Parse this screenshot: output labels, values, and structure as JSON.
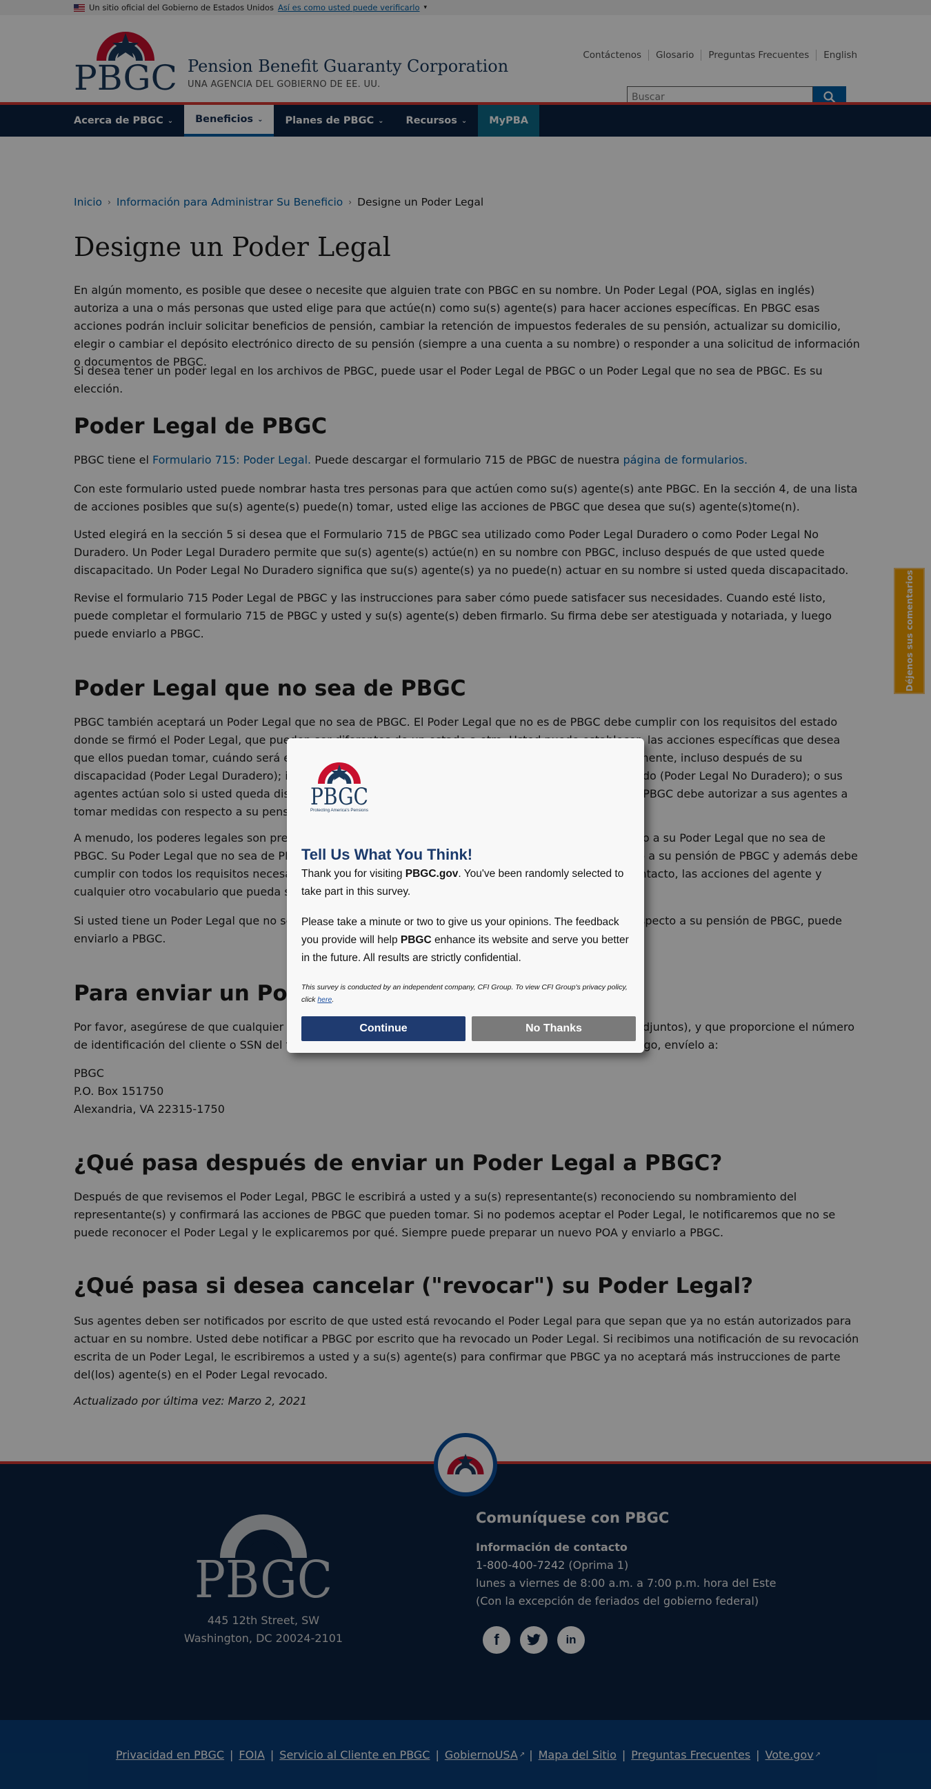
{
  "gov_banner": {
    "text": "Un sitio oficial del Gobierno de Estados Unidos",
    "link": "Así es como usted puede verificarlo"
  },
  "header": {
    "org_name": "Pension Benefit Guaranty Corporation",
    "org_sub": "UNA AGENCIA DEL GOBIERNO DE EE. UU.",
    "util_links": [
      "Contáctenos",
      "Glosario",
      "Preguntas Frecuentes",
      "English"
    ],
    "search_placeholder": "Buscar"
  },
  "nav": [
    {
      "label": "Acerca de PBGC",
      "active": false
    },
    {
      "label": "Beneficios",
      "active": true
    },
    {
      "label": "Planes de PBGC",
      "active": false
    },
    {
      "label": "Recursos",
      "active": false
    },
    {
      "label": "MyPBA",
      "active": false
    }
  ],
  "breadcrumb": [
    "Inicio",
    "Información para Administrar Su Beneficio",
    "Designe un Poder Legal"
  ],
  "page_title": "Designe un Poder Legal",
  "intro": [
    "En algún momento, es posible que desee o necesite que alguien trate con PBGC en su nombre. Un Poder Legal (POA, siglas en inglés) autoriza a una o más personas que usted elige para que actúe(n) como su(s) agente(s) para hacer acciones específicas. En PBGC esas acciones podrán incluir solicitar beneficios de pensión, cambiar la retención de impuestos federales de su pensión, actualizar su domicilio, elegir o cambiar el depósito electrónico directo de su pensión (siempre a una cuenta a su nombre) o responder a una solicitud de información o documentos de PBGC.",
    "Si desea tener un poder legal en los archivos de PBGC, puede usar el Poder Legal de PBGC o un Poder Legal que no sea de PBGC. Es su elección."
  ],
  "section1": {
    "heading": "Poder Legal de PBGC",
    "p1_pre": "PBGC tiene el",
    "p1_link1": " Formulario 715: Poder Legal.",
    "p1_mid": " Puede descargar el formulario 715 de PBGC de nuestra ",
    "p1_link2": "página de formularios.",
    "paras": [
      "Con este formulario usted puede nombrar hasta tres personas para que actúen como su(s) agente(s) ante PBGC. En la sección 4, de una lista de acciones posibles que su(s) agente(s) puede(n) tomar, usted elige las acciones de PBGC que desea que su(s) agente(s)tome(n).",
      "Usted elegirá en la sección 5 si desea que el Formulario 715 de PBGC sea utilizado como Poder Legal Duradero o como Poder Legal No Duradero. Un Poder Legal Duradero permite que su(s) agente(s) actúe(n) en su nombre con PBGC, incluso después de que usted quede discapacitado. Un Poder Legal No Duradero significa que su(s) agente(s) ya no puede(n) actuar en su nombre si usted queda discapacitado.",
      "Revise el formulario 715 Poder Legal de PBGC y las instrucciones para saber cómo puede satisfacer sus necesidades. Cuando esté listo, puede completar el formulario 715 de PBGC y usted y su(s) agente(s) deben firmarlo. Su firma debe ser atestiguada y notariada, y luego puede enviarlo a PBGC."
    ]
  },
  "section2": {
    "heading": "Poder Legal que no sea de PBGC",
    "paras": [
      "PBGC también aceptará un Poder Legal que no sea de PBGC. El Poder Legal que no es de PBGC debe cumplir con los requisitos del estado donde se firmó el Poder Legal, que pueden ser diferentes de un estado a otro. Usted puede establecer, las acciones específicas que desea que ellos puedan tomar, cuándo será efectivo el Poder Legal, si sus agentes pueden actuar inmediatamente, incluso después de su discapacidad (Poder Legal Duradero); inmediatamente, pero ya no pueden actuar si queda discapacitado (Poder Legal No Duradero); o sus agentes actúan solo si usted queda discapacitado. Tenga en cuenta que un Poder Legal que no sea de PBGC debe autorizar a sus agentes a tomar medidas con respecto a su pensión de PBGC.",
      "A menudo, los poderes legales son preparados por abogados. Usted puede hablar con uno con respecto a su Poder Legal que no sea de PBGC. Su Poder Legal que no sea de PBGC debe autorizar a sus agentes a tomar medidas con respecto a su pensión de PBGC y además debe cumplir con todos los requisitos necesarios de su estado. Le pedimos que incluya la información de contacto, las acciones del agente y cualquier otro vocabulario que pueda ser requeridos por su estado.",
      "Si usted tiene un Poder Legal que no sea de PBGC que autorice a sus agentes a tomar medidas con respecto a su pensión de PBGC, puede enviarlo a PBGC."
    ]
  },
  "section3": {
    "heading": "Para enviar un Poder Legal a PBGC",
    "para": "Por favor, asegúrese de que cualquier Poder Legal que nos envíe esté completo (incluyendo archivos adjuntos), y que proporcione el número de identificación del cliente o SSN del titular, así como su domicilio y número de teléfono actuales. Luego, envíelo a:",
    "address": [
      "PBGC",
      "P.O. Box 151750",
      "Alexandria, VA 22315-1750"
    ]
  },
  "section4": {
    "heading": "¿Qué pasa después de enviar un Poder Legal a PBGC?",
    "para": "Después de que revisemos el Poder Legal, PBGC le escribirá a usted y a su(s) representante(s) reconociendo su nombramiento del representante(s) y confirmará las acciones de PBGC que pueden tomar. Si no podemos aceptar el Poder Legal, le notificaremos que no se puede reconocer el Poder Legal y le explicaremos por qué. Siempre puede preparar un nuevo POA y enviarlo a PBGC."
  },
  "section5": {
    "heading": "¿Qué pasa si desea cancelar (\"revocar\") su Poder Legal?",
    "para": "Sus agentes deben ser notificados por escrito de que usted está revocando el Poder Legal para que sepan que ya no están autorizados para actuar en su nombre. Usted debe notificar a PBGC por escrito que ha revocado un Poder Legal. Si recibimos una notificación de su revocación escrita de un Poder Legal, le escribiremos a usted y a su(s) agente(s) para confirmar que PBGC ya no aceptará más instrucciones de parte del(los) agente(s) en el Poder Legal revocado.",
    "updated": "Actualizado por última vez: Marzo 2, 2021"
  },
  "feedback_tab": "Déjenos sus comentarios",
  "footer": {
    "logo_text": "PBGC",
    "address": [
      "445 12th Street, SW",
      "Washington, DC 20024-2101"
    ],
    "contact_heading": "Comuníquese con PBGC",
    "contact_label": "Información de contacto",
    "phone": "1-800-400-7242",
    "phone_note": " (Oprima 1)",
    "hours": "lunes a viernes de 8:00 a.m. a 7:00 p.m. hora del Este",
    "holidays": "(Con la excepción de feriados del gobierno federal)",
    "bottom_links": [
      "Privacidad en PBGC",
      "FOIA",
      "Servicio al Cliente en PBGC",
      "GobiernoUSA",
      "Mapa del Sitio",
      "Preguntas Frecuentes",
      "Vote.gov"
    ]
  },
  "modal": {
    "logo_text": "PBGC",
    "logo_tagline": "Protecting America's Pensions",
    "title": "Tell Us What You Think!",
    "line1_pre": "Thank you for visiting ",
    "line1_bold": "PBGC.gov",
    "line1_post": ". You've been randomly selected to take part in this survey.",
    "line2_pre": "Please take a minute or two to give us your opinions. The feedback you provide will help ",
    "line2_bold": "PBGC",
    "line2_post": " enhance its website and serve you better in the future. All results are strictly confidential.",
    "fine_pre": "This survey is conducted by an independent company, CFI Group. To view CFI Group's privacy policy, click ",
    "fine_link": "here",
    "fine_post": ".",
    "continue": "Continue",
    "no_thanks": "No Thanks"
  },
  "colors": {
    "navy": "#0b2342",
    "accent_red": "#d83933",
    "link_blue": "#005ea2",
    "feedback_orange": "#f5a100",
    "modal_continue": "#1f3b70",
    "modal_nothanks": "#7a7a7a"
  }
}
